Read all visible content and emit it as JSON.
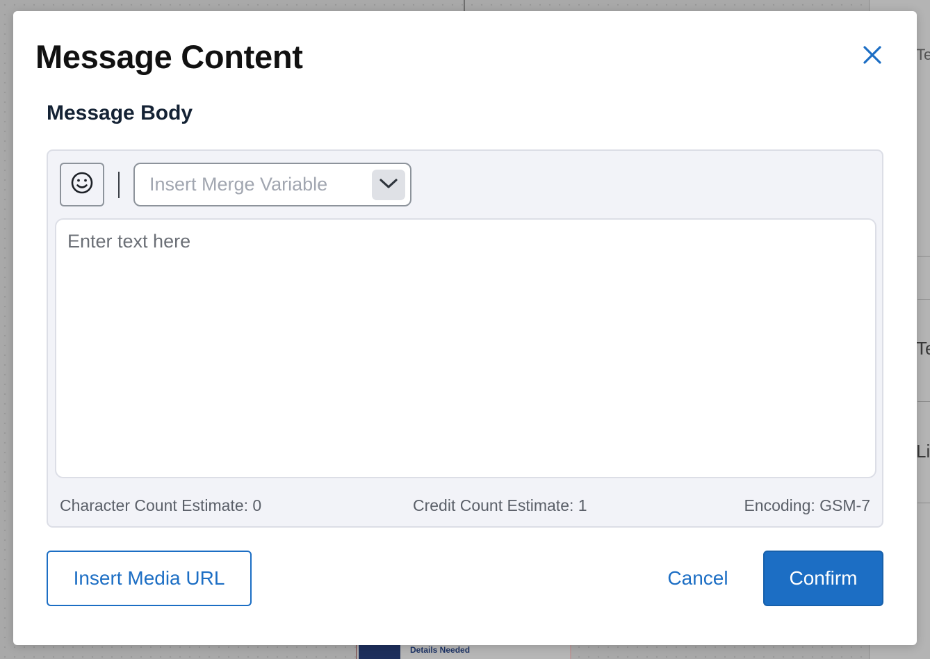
{
  "background": {
    "card_text": "Details Needed",
    "fragments": [
      "Te",
      "Te",
      "Li"
    ]
  },
  "modal": {
    "title": "Message Content",
    "close_icon": "close-icon",
    "section_label": "Message Body",
    "toolbar": {
      "emoji_icon": "smiley-face-icon",
      "merge_variable_placeholder": "Insert Merge Variable",
      "merge_chevron_icon": "chevron-down-icon"
    },
    "editor": {
      "placeholder": "Enter text here",
      "value": ""
    },
    "stats": {
      "character_count": "Character Count Estimate: 0",
      "credit_count": "Credit Count Estimate: 1",
      "encoding": "Encoding: GSM-7"
    },
    "buttons": {
      "insert_media": "Insert Media URL",
      "cancel": "Cancel",
      "confirm": "Confirm"
    }
  },
  "colors": {
    "accent": "#1c6ec4",
    "title": "#111111",
    "section_label": "#142234",
    "panel_bg": "#f2f3f8"
  }
}
